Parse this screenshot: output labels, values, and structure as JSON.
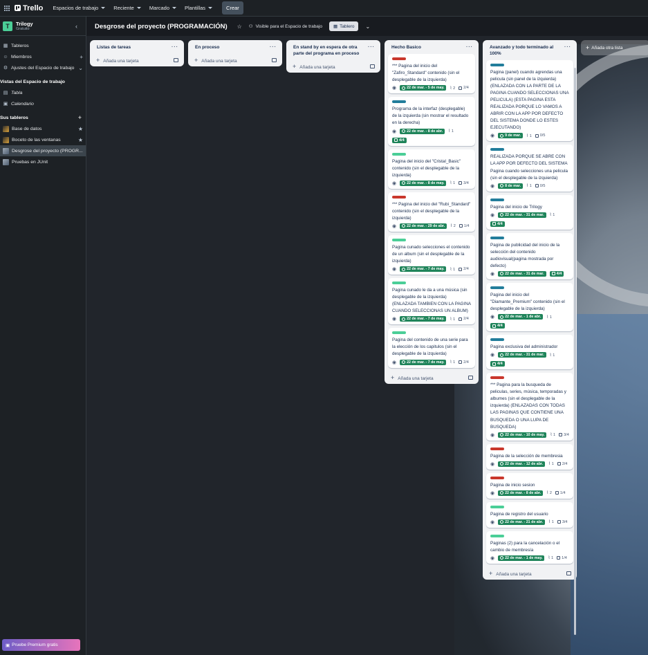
{
  "topbar": {
    "app_name": "Trello",
    "nav": [
      "Espacios de trabajo",
      "Reciente",
      "Marcado",
      "Plantillas"
    ],
    "create_label": "Crear"
  },
  "sidebar": {
    "workspace_initial": "T",
    "workspace_name": "Trilogy",
    "workspace_plan": "Gratuito",
    "collapse_icon": "‹",
    "items": [
      {
        "label": "Tableros",
        "icon": "board-icon"
      },
      {
        "label": "Miembros",
        "icon": "member-icon"
      },
      {
        "label": "Ajustes del Espacio de trabajo",
        "icon": "settings-icon"
      }
    ],
    "views_heading": "Vistas del Espacio de trabajo",
    "views": [
      {
        "label": "Tabla",
        "icon": "table-icon"
      },
      {
        "label": "Calendario",
        "icon": "calendar-icon"
      }
    ],
    "boards_heading": "Sus tableros",
    "boards": [
      {
        "label": "Base de datos",
        "starred": true
      },
      {
        "label": "Boceto de las ventanas",
        "starred": true
      },
      {
        "label": "Desgrose del proyecto (PROGR...",
        "starred": false,
        "active": true
      },
      {
        "label": "Pruebas en JUnit",
        "starred": false
      }
    ],
    "premium_label": "Pruebe Premium gratis"
  },
  "board": {
    "title": "Desgrose del proyecto (PROGRAMACIÓN)",
    "visibility": "Visible para el Espacio de trabajo",
    "view_label": "Tablero",
    "add_list_label": "Añada otra lista",
    "add_card_label": "Añada una tarjeta",
    "lists": [
      {
        "title": "Listas de tareas",
        "cards": []
      },
      {
        "title": "En proceso",
        "cards": []
      },
      {
        "title": "En stand by en espera de otra parte del programa en proceso",
        "cards": []
      },
      {
        "title": "Hecho Basico",
        "cards": [
          {
            "label_color": "#c9372c",
            "title": "*** Pagina del inicio del \"Zafiro_Standard\" contenido (sin el desplegable de la izquierda)",
            "due": "22 de mar. - 5 de may.",
            "attachments": "2",
            "checklist": "2/4",
            "checklist_done": false
          },
          {
            "label_color": "#227d9b",
            "title": "Programa de la interfaz (desplegable) de la izquierda (sin mostrar el resultado en la derecha)",
            "due": "22 de mar. - 8 de abr.",
            "attachments": "1",
            "checklist": "4/4",
            "checklist_done": true
          },
          {
            "label_color": "#4bce97",
            "title": "Pagina del inicio del \"Cristal_Basic\" contenido (sin el desplegable de la izquierda)",
            "due": "22 de mar. - 8 de may.",
            "attachments": "1",
            "checklist": "3/4",
            "checklist_done": false
          },
          {
            "label_color": "#c9372c",
            "title": "*** Pagina del inicio del \"Rubi_Standard\" contenido (sin el desplegable de la izquierda)",
            "due": "22 de mar. - 29 de abr.",
            "attachments": "2",
            "checklist": "1/4",
            "checklist_done": false
          },
          {
            "label_color": "#4bce97",
            "title": "Pagina cunado selecciones el contenido de un album (sin el desplegable de la izquierda)",
            "due": "22 de mar. - 7 de may.",
            "attachments": "1",
            "checklist": "2/4",
            "checklist_done": false
          },
          {
            "label_color": "#4bce97",
            "title": "Pagina cunado le da a una música (sin desplegable de la izquierda) (ENLAZADA TAMBIEN CON LA PAGINA CUANDO SELECCIONAS UN ALBUM)",
            "due": "22 de mar. - 7 de may.",
            "attachments": "1",
            "checklist": "2/4",
            "checklist_done": false
          },
          {
            "label_color": "#4bce97",
            "title": "Pagina del contenido de una serie para la elección de los capitulos (sin el desplegable de la izquierda)",
            "due": "22 de mar. - 7 de may.",
            "attachments": "1",
            "checklist": "2/4",
            "checklist_done": false
          }
        ]
      },
      {
        "title": "Avanzado y todo terminado al 100%",
        "cards": [
          {
            "label_color": "#227d9b",
            "title": "Pagina (panel) cuando agrendas una pelicula (sin panel de la izquierda) (ENLAZADA CON LA PARTE DE LA PAGINA CUANDO SELECCIONAS UNA PELICULA) (ESTA PAGINA ESTA REALIZADA PORQUE LO VAMOS A ABRIR CON LA APP POR DEFECTO DEL SISTEMA DONDE LO ESTES EJECUTANDO)",
            "due": "9 de mar.",
            "attachments": "1",
            "checklist": "0/5",
            "checklist_done": false
          },
          {
            "label_color": "#227d9b",
            "title": "REALIZADA PORQUE SE ABRE CON LA APP POR DEFECTO DEL SISTEMA Pagina cuando selecciones una pelicula (sin el desplegable de la izquierda)",
            "due": "8 de mar.",
            "attachments": "1",
            "checklist": "0/5",
            "checklist_done": false
          },
          {
            "label_color": "#227d9b",
            "title": "Pagina del inicio de Trilogy",
            "due": "22 de mar. - 31 de mar.",
            "attachments": "1",
            "checklist": "4/4",
            "checklist_done": true
          },
          {
            "label_color": "#227d9b",
            "title": "Pagina de publicidad del inicio de la selección del contenido audiovisual(pagina mostrada por defecto)",
            "due": "22 de mar. - 31 de mar.",
            "attachments": "",
            "checklist": "4/4",
            "checklist_done": true
          },
          {
            "label_color": "#227d9b",
            "title": "Pagina del inicio del \"Diamante_Premium\" contenido (sin el desplegable de la izquierda)",
            "due": "22 de mar. - 1 de abr.",
            "attachments": "1",
            "checklist": "4/4",
            "checklist_done": true
          },
          {
            "label_color": "#227d9b",
            "title": "Pagina exclusiva del administrador",
            "due": "22 de mar. - 31 de mar.",
            "attachments": "1",
            "checklist": "4/4",
            "checklist_done": true
          },
          {
            "label_color": "#c9372c",
            "title": "*** Pagina para la busqueda de peliculas, series, música, temporadas y albumes (sin el desplegable de la izquierda) (ENLAZADAS CON TODAS LAS PAGINAS QUE CONTIENE UNA BUSQUEDA O UNA LUPA DE BUSQUEDA)",
            "due": "22 de mar. - 10 de may.",
            "attachments": "1",
            "checklist": "3/4",
            "checklist_done": false
          },
          {
            "label_color": "#c9372c",
            "title": "Pagina de la selección de membresia",
            "due": "22 de mar. - 12 de abr.",
            "attachments": "1",
            "checklist": "2/4",
            "checklist_done": false
          },
          {
            "label_color": "#c9372c",
            "title": "Pagina de inicio sesion",
            "due": "22 de mar. - 8 de abr.",
            "attachments": "2",
            "checklist": "1/4",
            "checklist_done": false
          },
          {
            "label_color": "#4bce97",
            "title": "Pagina de registro del usuario",
            "due": "22 de mar. - 21 de abr.",
            "attachments": "1",
            "checklist": "3/4",
            "checklist_done": false
          },
          {
            "label_color": "#4bce97",
            "title": "Paginas (2) para la cancelación o el cambio de membresía",
            "due": "22 de mar. - 1 de may.",
            "attachments": "1",
            "checklist": "1/4",
            "checklist_done": false
          }
        ]
      }
    ]
  }
}
